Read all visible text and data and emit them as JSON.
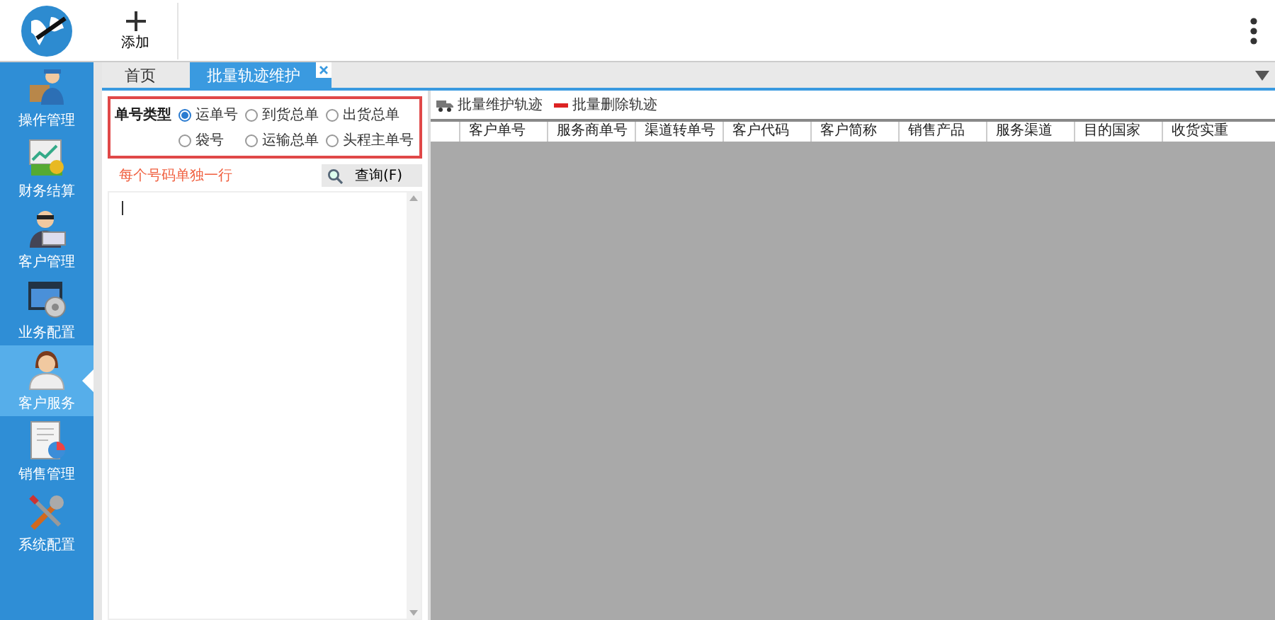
{
  "header": {
    "add_label": "添加"
  },
  "sidebar": {
    "items": [
      {
        "label": "操作管理",
        "kind": "operator",
        "selected": false
      },
      {
        "label": "财务结算",
        "kind": "finance",
        "selected": false
      },
      {
        "label": "客户管理",
        "kind": "customer",
        "selected": false
      },
      {
        "label": "业务配置",
        "kind": "config",
        "selected": false
      },
      {
        "label": "客户服务",
        "kind": "service",
        "selected": true
      },
      {
        "label": "销售管理",
        "kind": "sales",
        "selected": false
      },
      {
        "label": "系统配置",
        "kind": "tools",
        "selected": false
      }
    ]
  },
  "tabs": [
    {
      "label": "首页",
      "selected": false
    },
    {
      "label": "批量轨迹维护",
      "selected": true
    }
  ],
  "query": {
    "type_label": "单号类型",
    "options": [
      {
        "label": "运单号",
        "selected": true
      },
      {
        "label": "到货总单",
        "selected": false
      },
      {
        "label": "出货总单",
        "selected": false
      },
      {
        "label": "袋号",
        "selected": false
      },
      {
        "label": "运输总单",
        "selected": false
      },
      {
        "label": "头程主单号",
        "selected": false
      }
    ],
    "hint": "每个号码单独一行",
    "button": "查询(F)"
  },
  "toolbar": [
    {
      "label": "批量维护轨迹",
      "kind": "maintain"
    },
    {
      "label": "批量删除轨迹",
      "kind": "delete"
    }
  ],
  "table": {
    "columns": [
      "客户单号",
      "服务商单号",
      "渠道转单号",
      "客户代码",
      "客户简称",
      "销售产品",
      "服务渠道",
      "目的国家",
      "收货实重"
    ]
  }
}
